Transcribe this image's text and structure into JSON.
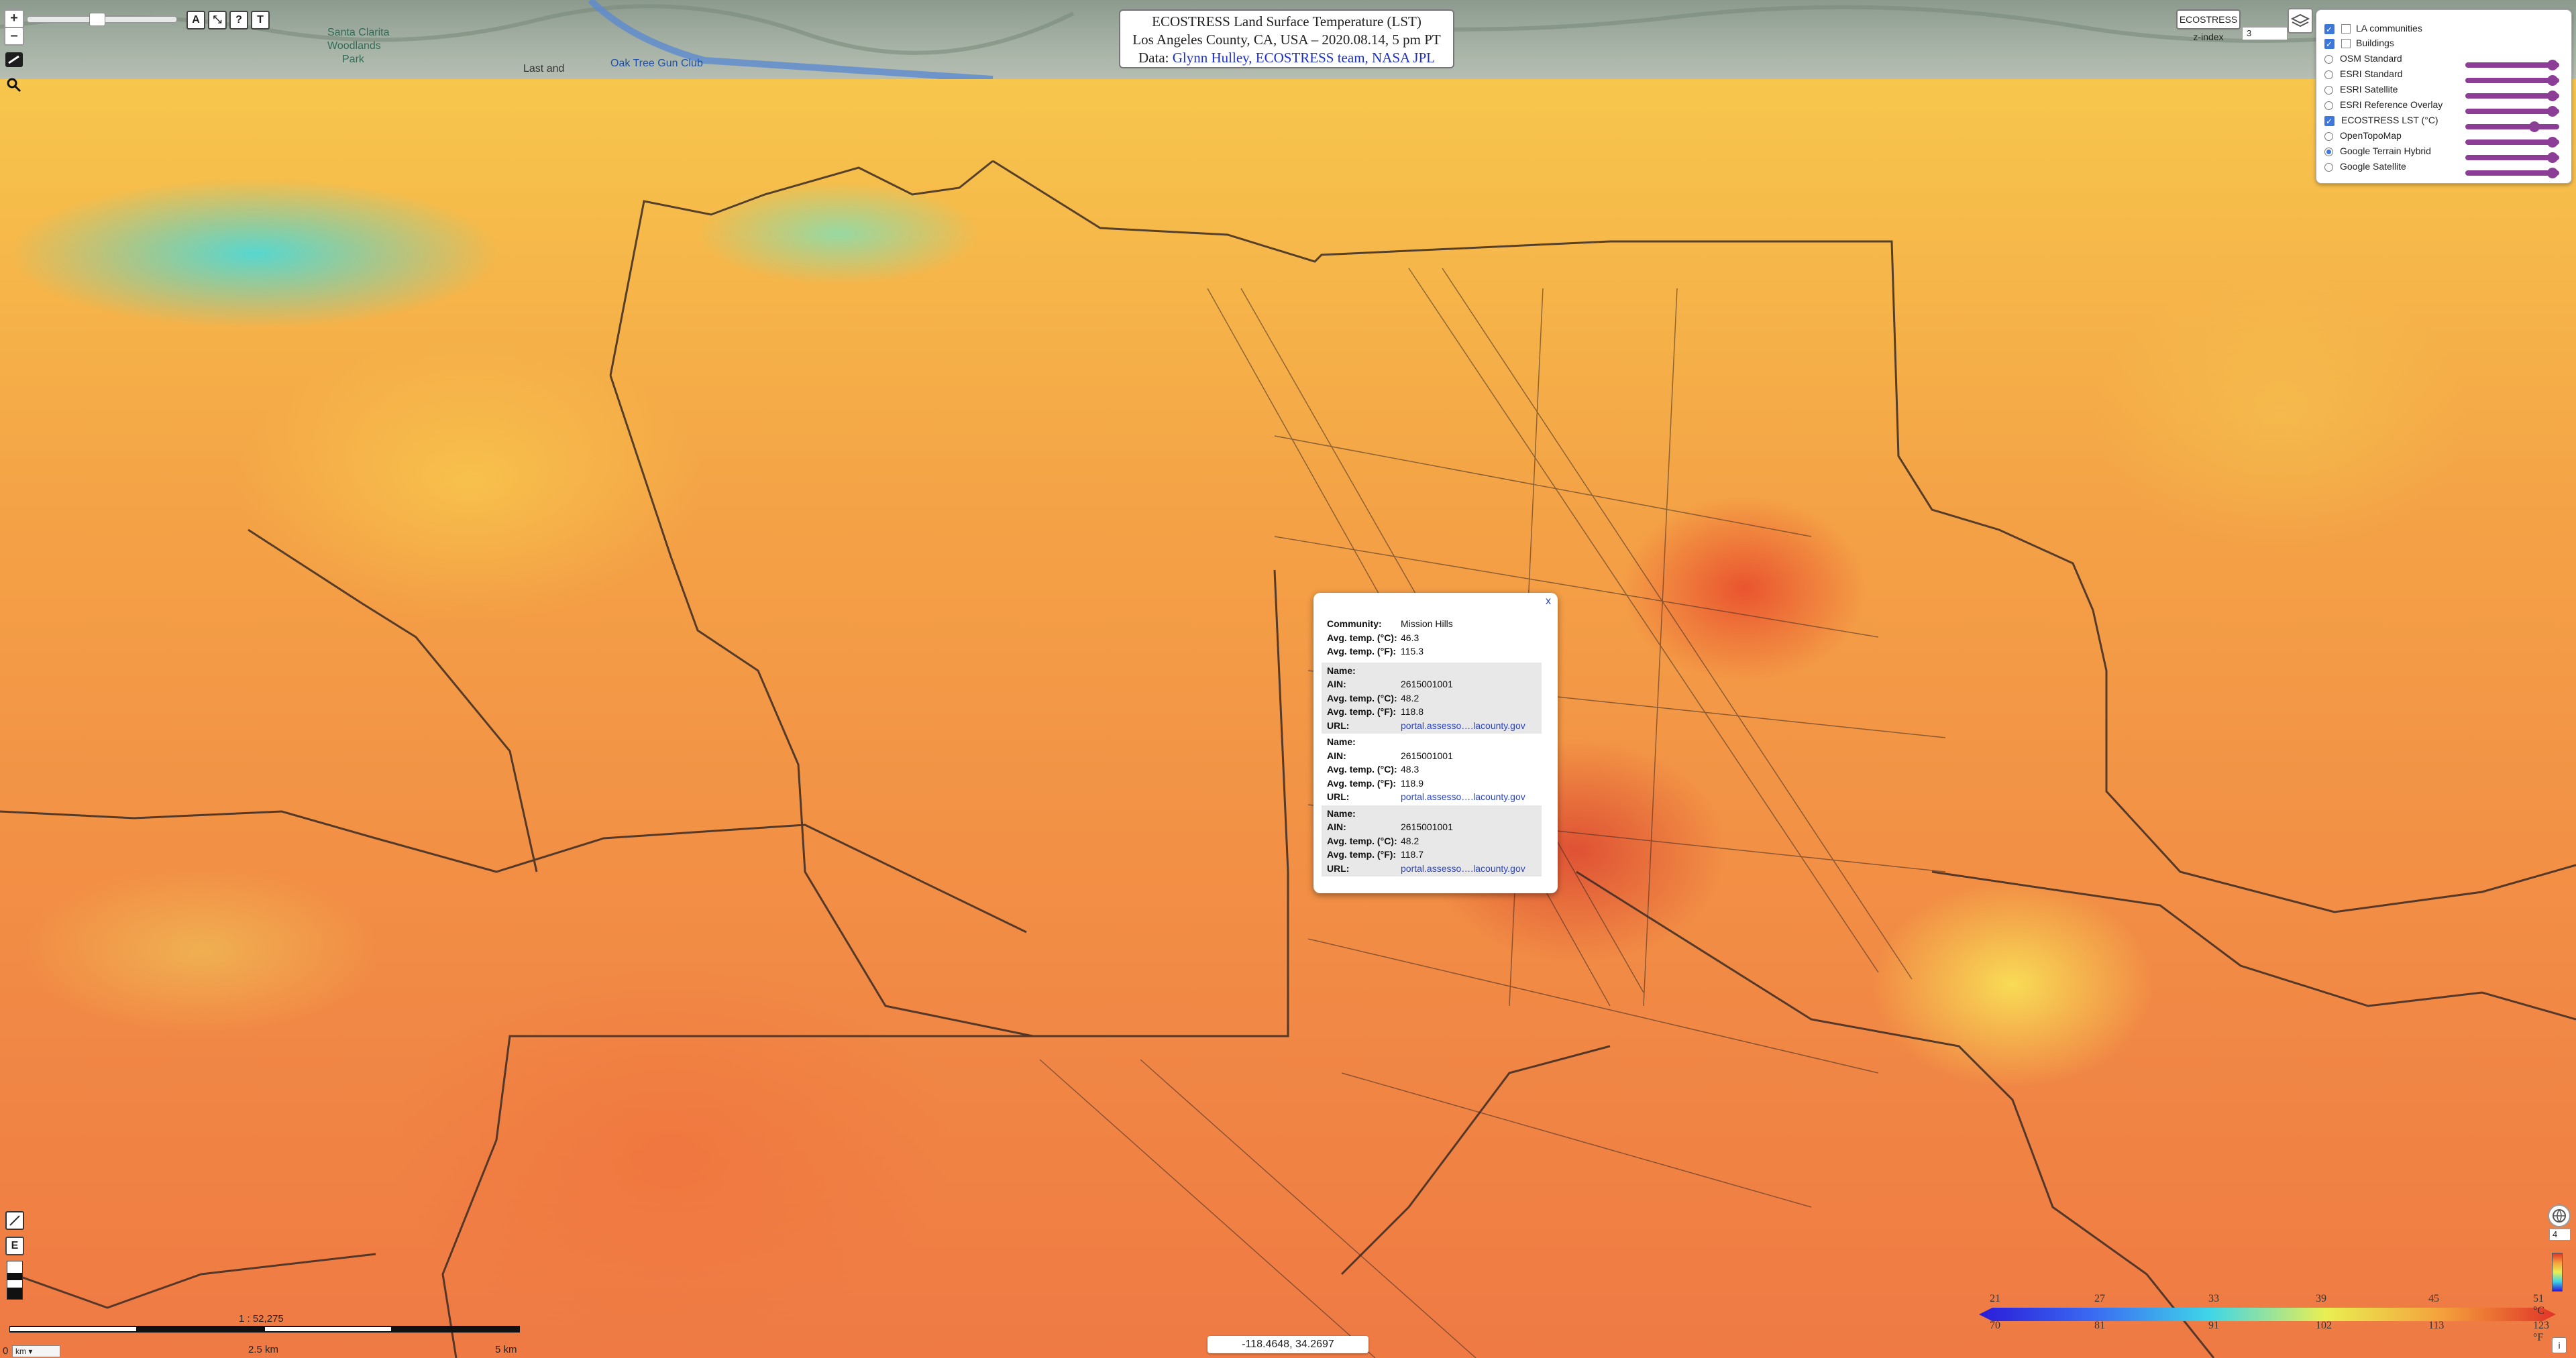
{
  "title": {
    "line1": "ECOSTRESS Land Surface Temperature (LST)",
    "line2": "Los Angeles County, CA, USA – 2020.08.14, 5 pm PT",
    "line3_prefix": "Data: ",
    "line3_link": "Glynn Hulley, ECOSTRESS team, NASA JPL"
  },
  "map_labels": {
    "place1": "Santa Clarita",
    "place2": "Woodlands",
    "place3": "Park",
    "place4": "Oak Tree Gun Club",
    "place5": "Last and"
  },
  "controls": {
    "zoom_in": "+",
    "zoom_out": "–",
    "tool_a": "A",
    "tool_b": "⤡",
    "tool_help": "?",
    "tool_t": "T",
    "ecostress_zindex_label": "ECOSTRESS z-index",
    "ecostress_zindex_value": "3",
    "bottom_right_value": "4",
    "edit_label": "E"
  },
  "layers": [
    {
      "label": "LA communities",
      "type": "checkbox",
      "checked": true
    },
    {
      "label": "Buildings",
      "type": "checkbox",
      "checked": true
    },
    {
      "label": "OSM Standard",
      "type": "radio",
      "checked": false,
      "opacity": 0.98
    },
    {
      "label": "ESRI Standard",
      "type": "radio",
      "checked": false,
      "opacity": 0.98
    },
    {
      "label": "ESRI Satellite",
      "type": "radio",
      "checked": false,
      "opacity": 0.98
    },
    {
      "label": "ESRI Reference Overlay",
      "type": "radio",
      "checked": false,
      "opacity": 0.98
    },
    {
      "label": "ECOSTRESS LST (°C)",
      "type": "checkbox",
      "checked": true,
      "opacity": 0.77
    },
    {
      "label": "OpenTopoMap",
      "type": "radio",
      "checked": false,
      "opacity": 0.98
    },
    {
      "label": "Google Terrain Hybrid",
      "type": "radio",
      "checked": true,
      "opacity": 0.98
    },
    {
      "label": "Google Satellite",
      "type": "radio",
      "checked": false,
      "opacity": 0.98
    }
  ],
  "popup": {
    "close": "x",
    "community_key": "Community:",
    "community_value": "Mission Hills",
    "avg_c_key": "Avg. temp. (°C):",
    "avg_c_value": "46.3",
    "avg_f_key": "Avg. temp. (°F):",
    "avg_f_value": "115.3",
    "parcels": [
      {
        "name_key": "Name:",
        "name": "",
        "ain_key": "AIN:",
        "ain": "2615001001",
        "c_key": "Avg. temp. (°C):",
        "c": "48.2",
        "f_key": "Avg. temp. (°F):",
        "f": "118.8",
        "url_key": "URL:",
        "url": "portal.assesso….lacounty.gov"
      },
      {
        "name_key": "Name:",
        "name": "",
        "ain_key": "AIN:",
        "ain": "2615001001",
        "c_key": "Avg. temp. (°C):",
        "c": "48.3",
        "f_key": "Avg. temp. (°F):",
        "f": "118.9",
        "url_key": "URL:",
        "url": "portal.assesso….lacounty.gov"
      },
      {
        "name_key": "Name:",
        "name": "",
        "ain_key": "AIN:",
        "ain": "2615001001",
        "c_key": "Avg. temp. (°C):",
        "c": "48.2",
        "f_key": "Avg. temp. (°F):",
        "f": "118.7",
        "url_key": "URL:",
        "url": "portal.assesso….lacounty.gov"
      }
    ]
  },
  "coordinates": "-118.4648, 34.2697",
  "scale": {
    "ratio": "1 : 52,275",
    "mid": "2.5 km",
    "end": "5 km",
    "zero": "0",
    "unit": "km"
  },
  "legend": {
    "celsius": [
      "21",
      "27",
      "33",
      "39",
      "45",
      "51 °C"
    ],
    "fahrenheit": [
      "70",
      "81",
      "91",
      "102",
      "113",
      "123 °F"
    ],
    "colors": [
      "#2a1bd8",
      "#3a6cf2",
      "#3fd6e8",
      "#e9ef52",
      "#f4a23c",
      "#e03428"
    ]
  },
  "info_icon": "i"
}
